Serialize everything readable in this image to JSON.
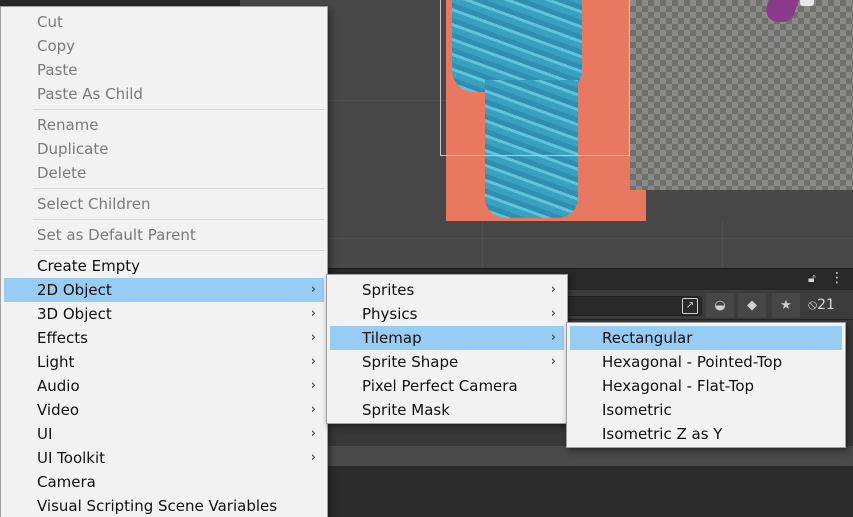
{
  "scene": {
    "visible": true
  },
  "toolbar": {
    "visible_count": "21"
  },
  "context_menu": {
    "groups": [
      [
        {
          "label": "Cut",
          "enabled": false
        },
        {
          "label": "Copy",
          "enabled": false
        },
        {
          "label": "Paste",
          "enabled": false
        },
        {
          "label": "Paste As Child",
          "enabled": false
        }
      ],
      [
        {
          "label": "Rename",
          "enabled": false
        },
        {
          "label": "Duplicate",
          "enabled": false
        },
        {
          "label": "Delete",
          "enabled": false
        }
      ],
      [
        {
          "label": "Select Children",
          "enabled": false
        }
      ],
      [
        {
          "label": "Set as Default Parent",
          "enabled": false
        }
      ],
      [
        {
          "label": "Create Empty",
          "enabled": true
        },
        {
          "label": "2D Object",
          "enabled": true,
          "submenu": true,
          "highlighted": true
        },
        {
          "label": "3D Object",
          "enabled": true,
          "submenu": true
        },
        {
          "label": "Effects",
          "enabled": true,
          "submenu": true
        },
        {
          "label": "Light",
          "enabled": true,
          "submenu": true
        },
        {
          "label": "Audio",
          "enabled": true,
          "submenu": true
        },
        {
          "label": "Video",
          "enabled": true,
          "submenu": true
        },
        {
          "label": "UI",
          "enabled": true,
          "submenu": true
        },
        {
          "label": "UI Toolkit",
          "enabled": true,
          "submenu": true
        },
        {
          "label": "Camera",
          "enabled": true
        },
        {
          "label": "Visual Scripting Scene Variables",
          "enabled": true
        }
      ]
    ]
  },
  "submenu_2d": {
    "items": [
      {
        "label": "Sprites",
        "submenu": true
      },
      {
        "label": "Physics",
        "submenu": true
      },
      {
        "label": "Tilemap",
        "submenu": true,
        "highlighted": true
      },
      {
        "label": "Sprite Shape",
        "submenu": true
      },
      {
        "label": "Pixel Perfect Camera"
      },
      {
        "label": "Sprite Mask"
      }
    ]
  },
  "submenu_tilemap": {
    "items": [
      {
        "label": "Rectangular",
        "highlighted": true
      },
      {
        "label": "Hexagonal - Pointed-Top"
      },
      {
        "label": "Hexagonal - Flat-Top"
      },
      {
        "label": "Isometric"
      },
      {
        "label": "Isometric Z as Y"
      }
    ]
  },
  "colors": {
    "highlight": "#99ccf3",
    "menu_bg": "#f2f2f2",
    "disabled_text": "#7a7a7a"
  }
}
